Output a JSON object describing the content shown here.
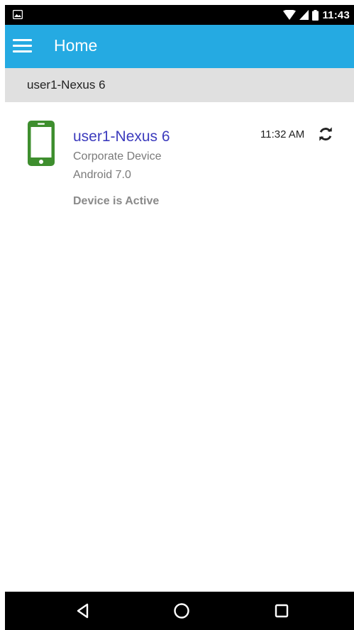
{
  "status_bar": {
    "time": "11:43"
  },
  "app_bar": {
    "title": "Home",
    "menu_icon": "hamburger-menu-icon"
  },
  "section": {
    "title": "user1-Nexus 6"
  },
  "device": {
    "name": "user1-Nexus 6",
    "type": "Corporate Device",
    "os": "Android 7.0",
    "status": "Device is Active",
    "time": "11:32 AM",
    "icon": "smartphone-icon",
    "sync_icon": "sync-icon"
  },
  "nav_bar": {
    "back_icon": "back-icon",
    "home_icon": "home-icon",
    "recents_icon": "recents-icon"
  },
  "colors": {
    "app_bar": "#25aae2",
    "device_name": "#3c3bbd",
    "phone_icon": "#3e8e2e",
    "section_header": "#e0e0e0"
  }
}
